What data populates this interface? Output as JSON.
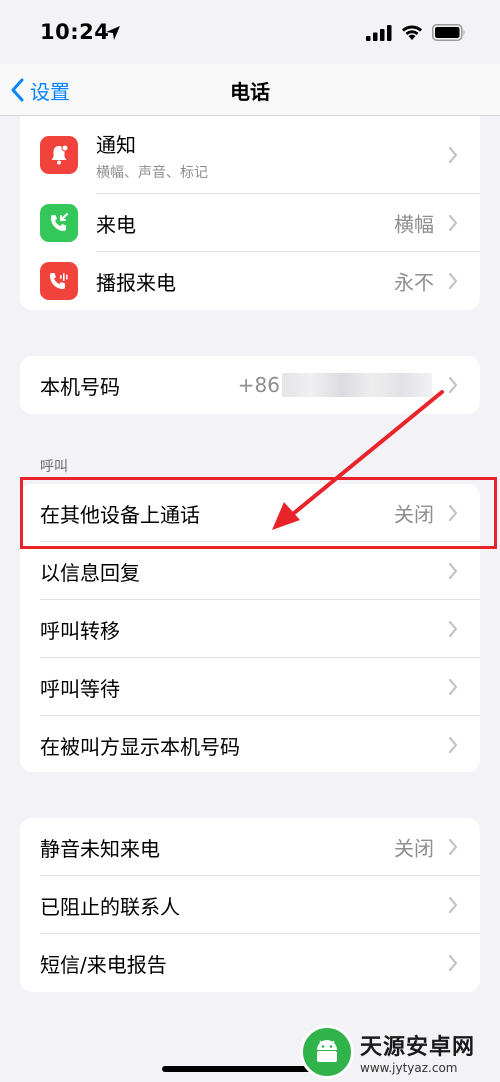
{
  "status_bar": {
    "time": "10:24"
  },
  "nav": {
    "back_label": "设置",
    "title": "电话"
  },
  "group1": {
    "items": [
      {
        "label": "通知",
        "subtitle": "横幅、声音、标记",
        "value": ""
      },
      {
        "label": "来电",
        "value": "横幅"
      },
      {
        "label": "播报来电",
        "value": "永不"
      }
    ]
  },
  "group2": {
    "items": [
      {
        "label": "本机号码",
        "value": "+86"
      }
    ]
  },
  "calls_section": {
    "header": "呼叫",
    "items": [
      {
        "label": "在其他设备上通话",
        "value": "关闭"
      },
      {
        "label": "以信息回复",
        "value": ""
      },
      {
        "label": "呼叫转移",
        "value": ""
      },
      {
        "label": "呼叫等待",
        "value": ""
      },
      {
        "label": "在被叫方显示本机号码",
        "value": ""
      }
    ]
  },
  "group4": {
    "items": [
      {
        "label": "静音未知来电",
        "value": "关闭"
      },
      {
        "label": "已阻止的联系人",
        "value": ""
      },
      {
        "label": "短信/来电报告",
        "value": ""
      }
    ]
  },
  "watermark": {
    "name": "天源安卓网",
    "url": "www.jytyaz.com"
  },
  "colors": {
    "accent": "#0a84ff",
    "red_icon": "#f2423c",
    "green_icon": "#34c759",
    "annotation_red": "#e8232a"
  }
}
